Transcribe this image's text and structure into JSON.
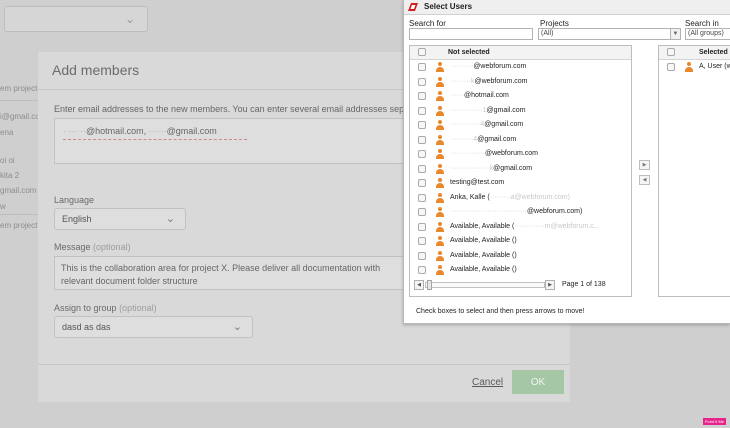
{
  "background": {
    "left_items": [
      "em project",
      "i@gmail.co",
      "ena",
      "oi oi",
      "kita 2",
      "gmail.com",
      "w",
      "em project"
    ]
  },
  "add_members": {
    "title": "Add members",
    "instructions": "Enter email addresses to the new members. You can enter several email addresses separ",
    "emails": {
      "blur_a": "· ···  ··",
      "part_a": "@hotmail.com,",
      "blur_b": " ······",
      "part_b": "@gmail.com"
    },
    "language_label": "Language",
    "language_value": "English",
    "message_label": "Message",
    "message_optional": "(optional)",
    "message_text": "This is the collaboration area for project X. Please deliver all documentation with relevant document folder structure",
    "group_label": "Assign to group",
    "group_optional": "(optional)",
    "group_value": "dasd as das",
    "cancel_label": "Cancel",
    "ok_label": "OK"
  },
  "select_users": {
    "title": "Select Users",
    "search_for_label": "Search for",
    "search_for_value": "",
    "projects_label": "Projects",
    "projects_value": "(All)",
    "search_in_label": "Search in",
    "search_in_value": "(All groups)",
    "not_selected_header": "Not selected",
    "selected_header": "Selected",
    "not_selected_rows": [
      {
        "blur": "··········",
        "text": "@webforum.com",
        "tail": ""
      },
      {
        "blur": "·········k",
        "text": "@webforum.com",
        "tail": ""
      },
      {
        "blur": "······",
        "text": "@hotmail.com",
        "tail": ""
      },
      {
        "blur": "··············1",
        "text": "@gmail.com",
        "tail": ""
      },
      {
        "blur": "·············4",
        "text": "@gmail.com",
        "tail": ""
      },
      {
        "blur": "··········4",
        "text": "@gmail.com",
        "tail": ""
      },
      {
        "blur": "···············",
        "text": "@webforum.com",
        "tail": ""
      },
      {
        "blur": "·················k",
        "text": "@gmail.com",
        "tail": ""
      },
      {
        "blur": "",
        "text": "testing@test.com",
        "tail": ""
      },
      {
        "blur": "",
        "text": "Anka, Kalle (",
        "tail": "·········a@webforum.com)"
      },
      {
        "blur": "·································",
        "text": "@webforum.com)",
        "tail": ""
      },
      {
        "blur": "",
        "text": "Available, Available (",
        "tail": "·············m@webforum.c..."
      },
      {
        "blur": "",
        "text": "Available, Available ()",
        "tail": ""
      },
      {
        "blur": "",
        "text": "Available, Available ()",
        "tail": ""
      },
      {
        "blur": "",
        "text": "Available, Available ()",
        "tail": ""
      }
    ],
    "selected_rows": [
      {
        "text": "A, User (w"
      }
    ],
    "pager_text": "Page 1 of 138",
    "footer_text": "Check boxes to select and then press arrows to move!"
  },
  "watermark": "Point It Me"
}
